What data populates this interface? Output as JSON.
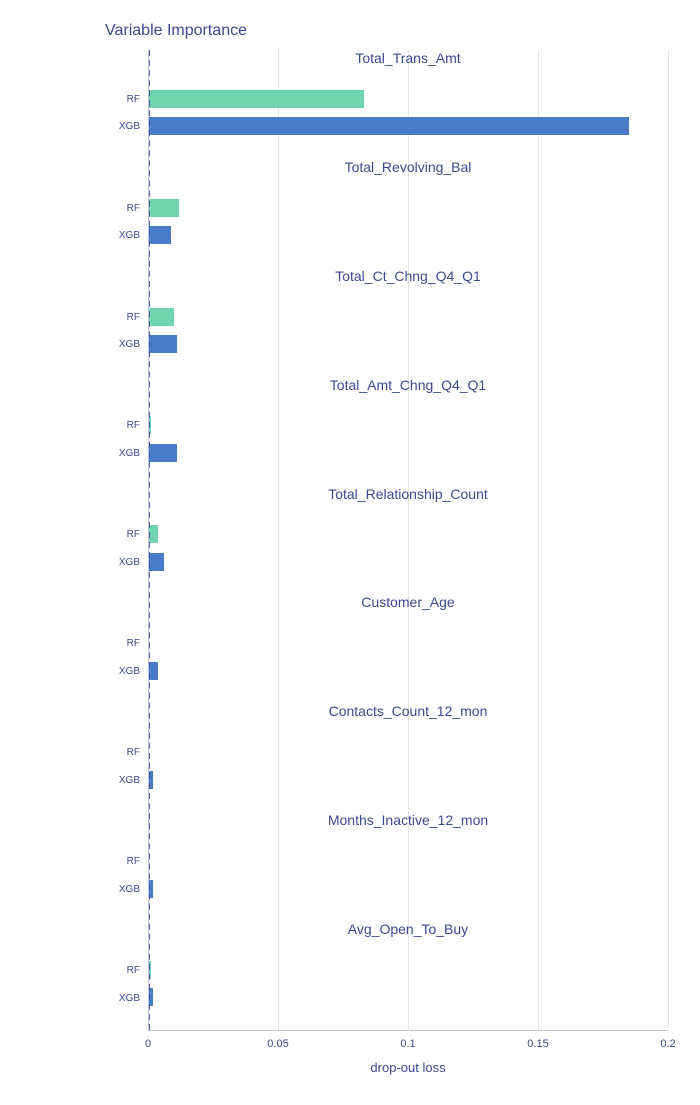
{
  "chart_data": {
    "type": "bar",
    "title": "Variable Importance",
    "xlabel": "drop-out loss",
    "ylabel": "",
    "xlim": [
      0,
      0.2
    ],
    "x_ticks": [
      0,
      0.05,
      0.1,
      0.15,
      0.2
    ],
    "categories": [
      "RF",
      "XGB"
    ],
    "colors": {
      "RF": "#6fd4af",
      "XGB": "#4a7bc7"
    },
    "panels": [
      {
        "variable": "Total_Trans_Amt",
        "RF": 0.083,
        "XGB": 0.185
      },
      {
        "variable": "Total_Revolving_Bal",
        "RF": 0.012,
        "XGB": 0.009
      },
      {
        "variable": "Total_Ct_Chng_Q4_Q1",
        "RF": 0.01,
        "XGB": 0.011
      },
      {
        "variable": "Total_Amt_Chng_Q4_Q1",
        "RF": 0.001,
        "XGB": 0.011
      },
      {
        "variable": "Total_Relationship_Count",
        "RF": 0.004,
        "XGB": 0.006
      },
      {
        "variable": "Customer_Age",
        "RF": 0.0005,
        "XGB": 0.004
      },
      {
        "variable": "Contacts_Count_12_mon",
        "RF": 0.0005,
        "XGB": 0.002
      },
      {
        "variable": "Months_Inactive_12_mon",
        "RF": 0.0005,
        "XGB": 0.002
      },
      {
        "variable": "Avg_Open_To_Buy",
        "RF": 0.001,
        "XGB": 0.002
      }
    ]
  }
}
